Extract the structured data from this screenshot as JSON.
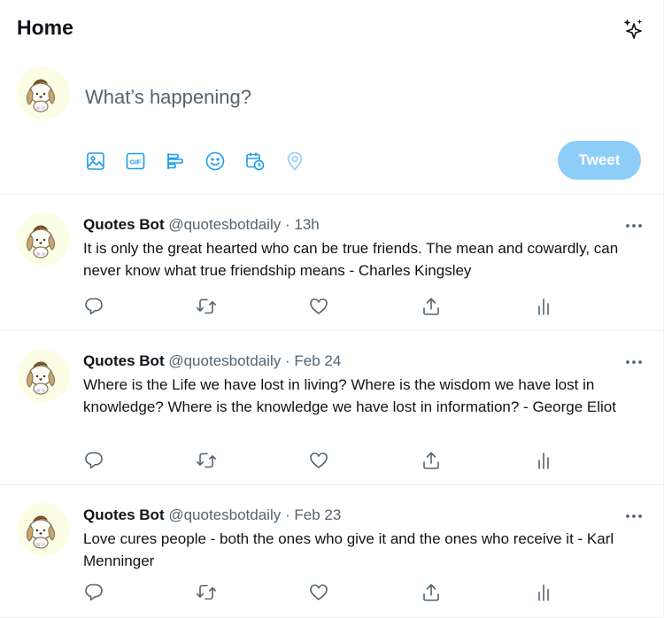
{
  "header": {
    "title": "Home",
    "sparkle_icon": "sparkle-icon"
  },
  "composer": {
    "placeholder": "What’s happening?",
    "tools": [
      "image-icon",
      "gif-icon",
      "poll-icon",
      "emoji-icon",
      "schedule-icon",
      "location-icon"
    ],
    "gif_label": "GIF",
    "tweet_button": "Tweet"
  },
  "colors": {
    "accent": "#1d9bf0",
    "tweet_button_disabled": "#8ecdf8",
    "secondary_text": "#536471",
    "avatar_bg": "#fbfde5"
  },
  "tweets": [
    {
      "name": "Quotes Bot",
      "handle": "@quotesbotdaily",
      "dot": "·",
      "time": "13h",
      "text": "It is only the great hearted who can be true friends. The mean and cowardly, can never know what true friendship means - Charles Kingsley"
    },
    {
      "name": "Quotes Bot",
      "handle": "@quotesbotdaily",
      "dot": "·",
      "time": "Feb 24",
      "text": "Where is the Life we have lost in living? Where is the wisdom we have lost in knowledge? Where is the knowledge we have lost in information? - George Eliot"
    },
    {
      "name": "Quotes Bot",
      "handle": "@quotesbotdaily",
      "dot": "·",
      "time": "Feb 23",
      "text": "Love cures people - both the ones who give it and the ones who receive it - Karl Menninger"
    }
  ]
}
